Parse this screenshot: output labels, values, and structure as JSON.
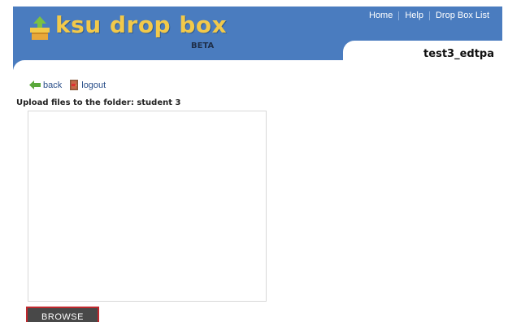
{
  "header": {
    "logo_text": "ksu drop box",
    "logo_badge": "BETA",
    "logo_icon": "dropbox-box-icon",
    "nav": [
      {
        "label": "Home"
      },
      {
        "label": "Help"
      },
      {
        "label": "Drop Box List"
      }
    ],
    "user_tab": "test3_edtpa"
  },
  "actions": {
    "back_label": "back",
    "logout_label": "logout"
  },
  "upload": {
    "label": "Upload files to the folder: student 3",
    "browse_label": "BROWSE"
  },
  "colors": {
    "header_bg": "#4a7cbf",
    "logo_text": "#f2c94a",
    "browse_bg": "#484848",
    "browse_border": "#c0282d",
    "link": "#2a4f8a"
  }
}
